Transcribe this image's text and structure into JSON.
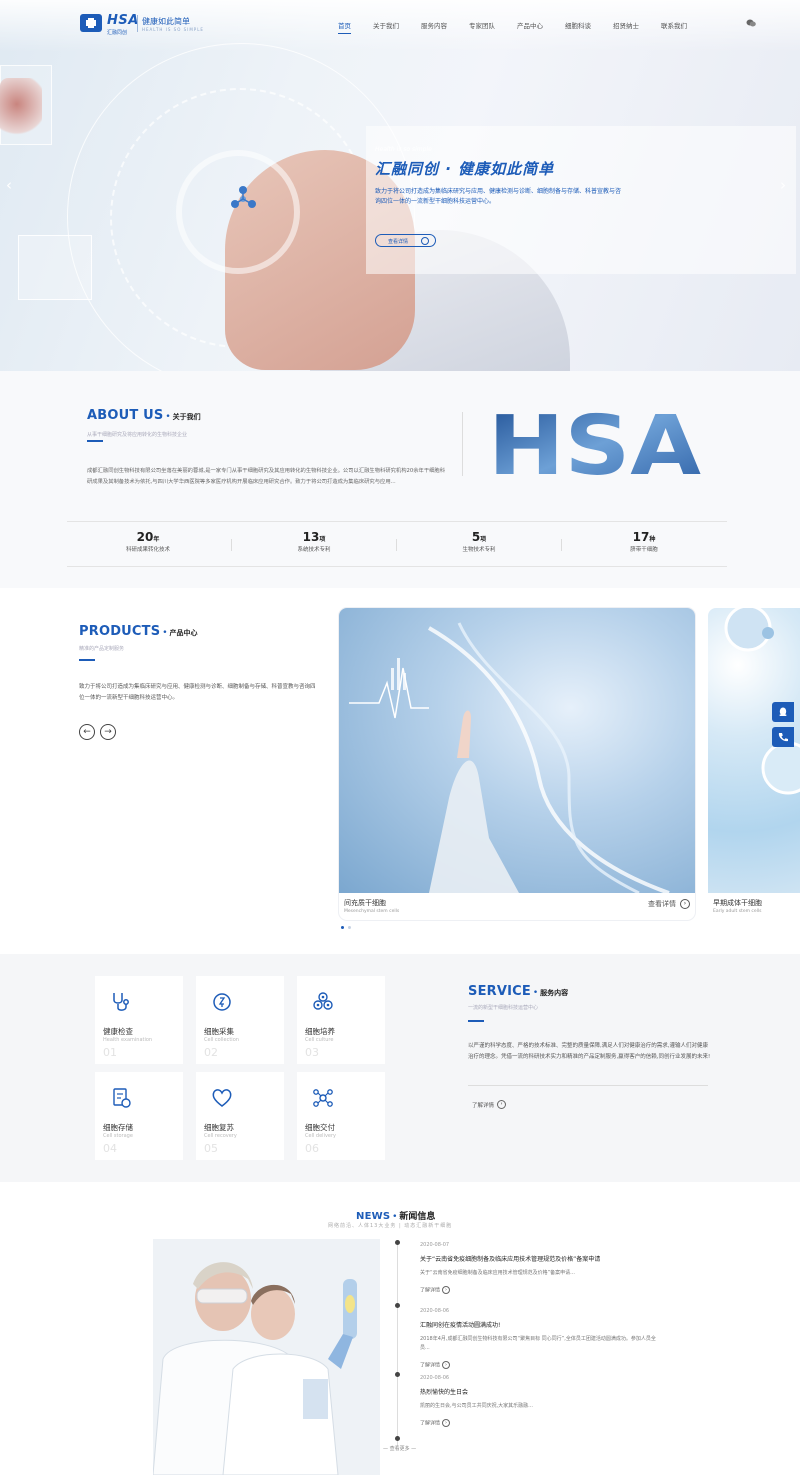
{
  "header": {
    "logo_text": "HSA",
    "logo_sub": "汇融同创",
    "slogan": "健康如此简单",
    "slogan_en": "HEALTH IS SO SIMPLE",
    "nav": [
      "首页",
      "关于我们",
      "服务内容",
      "专家团队",
      "产品中心",
      "细胞科谈",
      "招贤纳士",
      "联系我们"
    ],
    "wechat_icon": "wechat-icon"
  },
  "hero": {
    "tag": "Health is so simple",
    "title": "汇融同创 · 健康如此简单",
    "description": "致力于将公司打造成为集临床研究与应用、健康检测与诊断、细胞制备与存储、科普宣教与咨询四位一体的一流新型干细胞科技运营中心。",
    "button": "查看详情",
    "prev_arrow": "‹",
    "next_arrow": "›"
  },
  "about": {
    "title_en": "ABOUT US",
    "title_dot": "•",
    "title_cn": "关于我们",
    "subtitle": "从事干细胞研究及将应用转化的生物科技企业",
    "text": "成都汇融同创生物科技有限公司坐落在美丽的蓉城,是一家专门从事干细胞研究及其应用转化的生物科技企业。公司以汇融生物科研究机构20余年干细胞科研成果及其制备技术为依托,与四川大学华西医院等多家医疗机构开展临床应用研究合作。致力于将公司打造成为集临床研究与应用...",
    "logo_big": "HSA",
    "stats": [
      {
        "num": "20",
        "unit": "年",
        "label": "科研成果转化技术"
      },
      {
        "num": "13",
        "unit": "项",
        "label": "系统技术专利"
      },
      {
        "num": "5",
        "unit": "项",
        "label": "生物技术专利"
      },
      {
        "num": "17",
        "unit": "种",
        "label": "脐带干细胞"
      }
    ]
  },
  "products": {
    "title_en": "PRODUCTS",
    "title_dot": "•",
    "title_cn": "产品中心",
    "subtitle": "精准的产品定制服务",
    "text": "致力于将公司打造成为集临床研究与应用、健康检测与诊断、细胞制备与存储、科普宣教与咨询四位一体的一流新型干细胞科技运营中心。",
    "prev": "←",
    "next": "→",
    "cards": [
      {
        "name": "间充质干细胞",
        "en": "Mesenchymal stem cells",
        "more": "查看详情"
      },
      {
        "name": "早期成体干细胞",
        "en": "Early adult stem cells"
      }
    ]
  },
  "sidebar": {
    "qq_icon": "qq-icon",
    "phone_icon": "phone-icon"
  },
  "service": {
    "title_en": "SERVICE",
    "title_dot": "•",
    "title_cn": "服务内容",
    "subtitle": "一流的新型干细胞科技运营中心",
    "text": "以严谨的科学态度、严格的技术标准、完整的质量保障,满足人们对健康治疗的需求,灌输人们对健康治疗的理念。凭借一流的科研技术实力和精准的产品定制服务,赢得客户的信赖,同创行业发展的未来!",
    "more": "了解详情",
    "items": [
      {
        "cn": "健康检查",
        "en": "Health examination",
        "num": "01",
        "icon": "stethoscope-icon"
      },
      {
        "cn": "细胞采集",
        "en": "Cell collection",
        "num": "02",
        "icon": "collection-icon"
      },
      {
        "cn": "细胞培养",
        "en": "Cell culture",
        "num": "03",
        "icon": "culture-icon"
      },
      {
        "cn": "细胞存储",
        "en": "Cell storage",
        "num": "04",
        "icon": "storage-icon"
      },
      {
        "cn": "细胞复苏",
        "en": "Cell recovery",
        "num": "05",
        "icon": "heart-icon"
      },
      {
        "cn": "细胞交付",
        "en": "Cell delivery",
        "num": "06",
        "icon": "delivery-icon"
      }
    ]
  },
  "news": {
    "title_en": "NEWS",
    "title_dot": "•",
    "title_cn": "新闻信息",
    "subtitle": "网络前沿、人体13大业务 | 动态汇融新干细胞",
    "more_label": "了解详情",
    "load_more": "— 查看更多 —",
    "items": [
      {
        "date": "2020-08-07",
        "title": "关于“云南省免疫细胞制备及临床应用技术管理规范及价格”备案申请",
        "desc": "关于“云南省免疫细胞制备及临床应用技术管理规范及价格”备案申请..."
      },
      {
        "date": "2020-08-06",
        "title": "汇融同创在疫情活动圆满成功!",
        "desc": "2018年4月,成都汇融同创生物科技有限公司“聚焦目标 同心同行”,全体员工团建活动圆满成功。参加人员全员..."
      },
      {
        "date": "2020-08-06",
        "title": "热烈愉快的生日会",
        "desc": "凯丽的生日会,与公司员工共同庆祝,大家其乐融融..."
      }
    ]
  }
}
